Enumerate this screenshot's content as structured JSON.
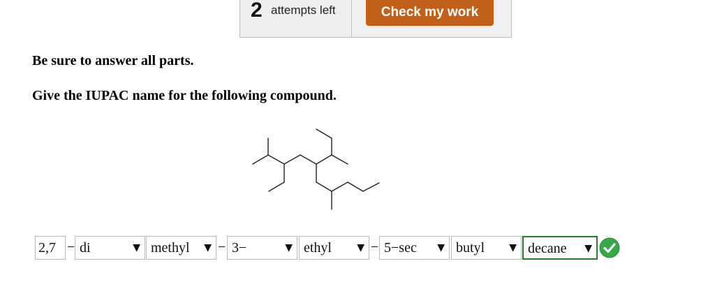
{
  "toolbar": {
    "attempts_count": "2",
    "attempts_label": "attempts left",
    "check_label": "Check my work"
  },
  "question": {
    "instruction": "Be sure to answer all parts.",
    "prompt": "Give the IUPAC name for the following compound."
  },
  "answer": {
    "locant1": "2,7",
    "dash": "−",
    "multiplier": "di",
    "substituent1": "methyl",
    "locant2": "3−",
    "substituent2": "ethyl",
    "locant3": "5−sec",
    "substituent3": "butyl",
    "parent": "decane",
    "caret": "▼",
    "parent_status": "correct"
  },
  "colors": {
    "accent_button": "#c0601a",
    "correct_border": "#2b7a2b",
    "correct_icon": "#3aa64a"
  }
}
